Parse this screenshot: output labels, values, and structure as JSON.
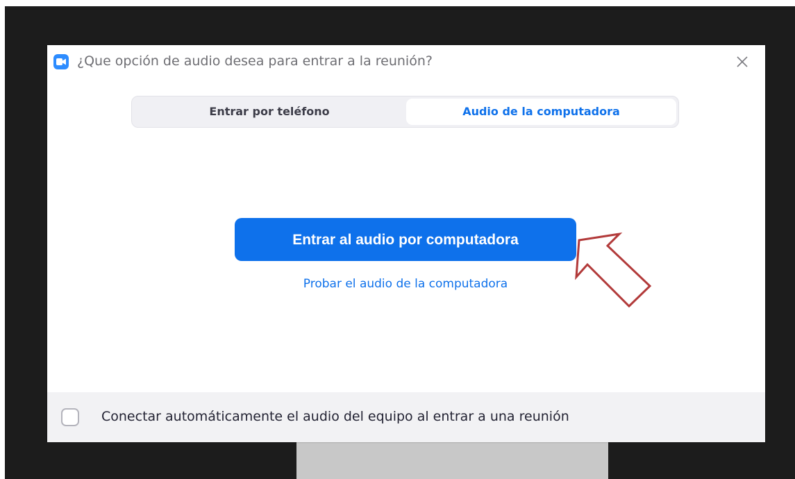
{
  "dialog": {
    "title": "¿Que opción de audio desea para entrar a la reunión?",
    "app_icon": "zoom-camera-icon",
    "close_icon": "close-icon"
  },
  "tabs": [
    {
      "label": "Entrar por teléfono",
      "selected": false
    },
    {
      "label": "Audio de la computadora",
      "selected": true
    }
  ],
  "main": {
    "join_button_label": "Entrar al audio por computadora",
    "test_link_label": "Probar el audio de la computadora"
  },
  "footer": {
    "auto_connect_label": "Conectar automáticamente el audio del equipo al entrar a una reunión",
    "auto_connect_checked": false
  },
  "colors": {
    "accent": "#0e71eb",
    "backdrop": "#1c1c1c",
    "annotation_arrow": "#b23a3a"
  }
}
